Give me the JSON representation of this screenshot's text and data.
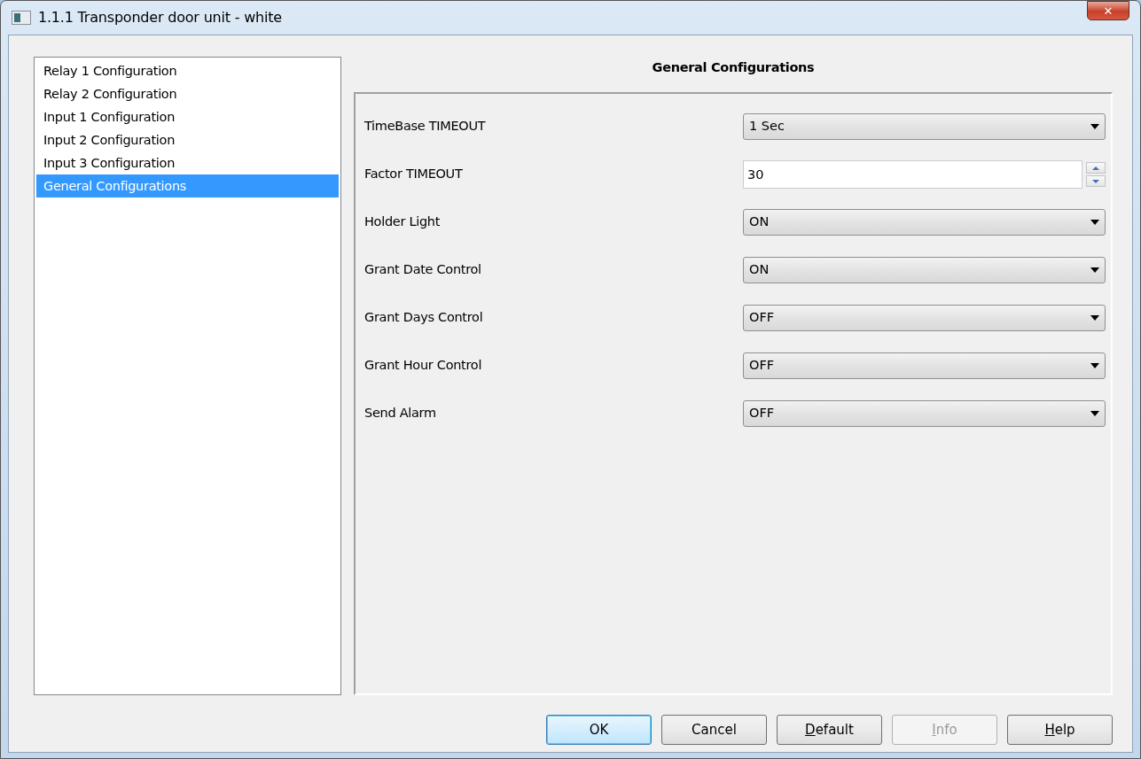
{
  "window": {
    "title": "1.1.1 Transponder door unit - white",
    "close": "✕"
  },
  "sidebar": {
    "items": [
      {
        "label": "Relay 1 Configuration",
        "selected": false
      },
      {
        "label": "Relay 2 Configuration",
        "selected": false
      },
      {
        "label": "Input 1 Configuration",
        "selected": false
      },
      {
        "label": "Input 2 Configuration",
        "selected": false
      },
      {
        "label": "Input 3 Configuration",
        "selected": false
      },
      {
        "label": "General Configurations",
        "selected": true
      }
    ]
  },
  "panel": {
    "title": "General Configurations",
    "fields": [
      {
        "label": "TimeBase TIMEOUT",
        "kind": "select",
        "value": "1 Sec"
      },
      {
        "label": "Factor TIMEOUT",
        "kind": "spin",
        "value": "30"
      },
      {
        "label": "Holder Light",
        "kind": "select",
        "value": "ON"
      },
      {
        "label": "Grant Date Control",
        "kind": "select",
        "value": "ON"
      },
      {
        "label": "Grant Days Control",
        "kind": "select",
        "value": "OFF"
      },
      {
        "label": "Grant Hour Control",
        "kind": "select",
        "value": "OFF"
      },
      {
        "label": "Send Alarm",
        "kind": "select",
        "value": "OFF"
      }
    ]
  },
  "buttons": [
    {
      "label_rest": "OK",
      "default": true,
      "disabled": false
    },
    {
      "label_rest": "Cancel",
      "default": false,
      "disabled": false
    },
    {
      "accel": "D",
      "label_rest": "efault",
      "default": false,
      "disabled": false
    },
    {
      "accel": "I",
      "label_rest": "nfo",
      "default": false,
      "disabled": true
    },
    {
      "accel": "H",
      "label_rest": "elp",
      "default": false,
      "disabled": false
    }
  ]
}
